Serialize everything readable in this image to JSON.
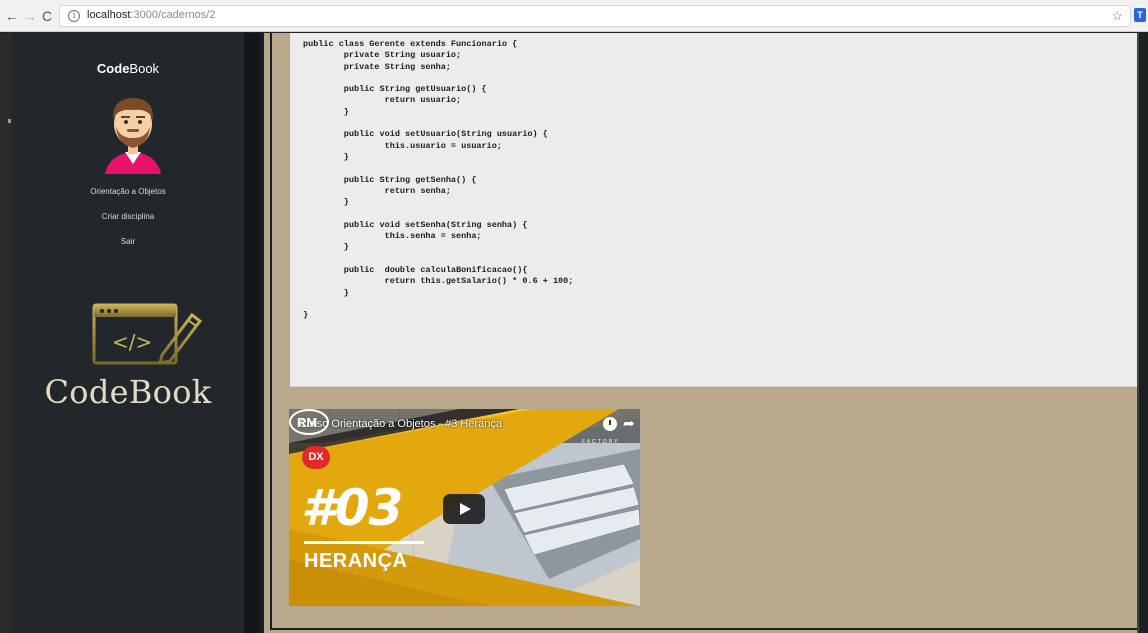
{
  "browser": {
    "url_host": "localhost",
    "url_path": ":3000/cadernos/2",
    "back_icon": "←",
    "forward_icon": "→",
    "reload_icon": "C",
    "info_icon": "i",
    "star_icon": "☆",
    "extension_icon": "T"
  },
  "sidebar": {
    "brand_bold": "Code",
    "brand_rest": "Book",
    "menu": [
      {
        "label": "Orientação a Objetos"
      },
      {
        "label": "Criar disciplina"
      },
      {
        "label": "Sair"
      }
    ],
    "logo_text": "CodeBook",
    "logo_symbol": "</>"
  },
  "code": {
    "text": "public class Gerente extends Funcionario {\n        private String usuario;\n        private String senha;\n\n        public String getUsuario() {\n                return usuario;\n        }\n\n        public void setUsuario(String usuario) {\n                this.usuario = usuario;\n        }\n\n        public String getSenha() {\n                return senha;\n        }\n\n        public void setSenha(String senha) {\n                this.senha = senha;\n        }\n\n        public  double calculaBonificacao(){\n                return this.getSalario() * 0.6 + 100;\n        }\n\n}"
  },
  "video": {
    "title": "Curso Orientação a Objetos - #3 Herança",
    "badge": "DX",
    "episode": "#03",
    "subtitle": "HERANÇA",
    "share_icon": "➦",
    "channel_logo_text": "RM",
    "factory_text": "FACTORY"
  },
  "colors": {
    "sidebar_bg": "#22272b",
    "main_bg": "#b8a78a",
    "code_bg": "#ececec",
    "logo_gold": "#e3dac2",
    "thumb_yellow": "#e3a80e"
  }
}
